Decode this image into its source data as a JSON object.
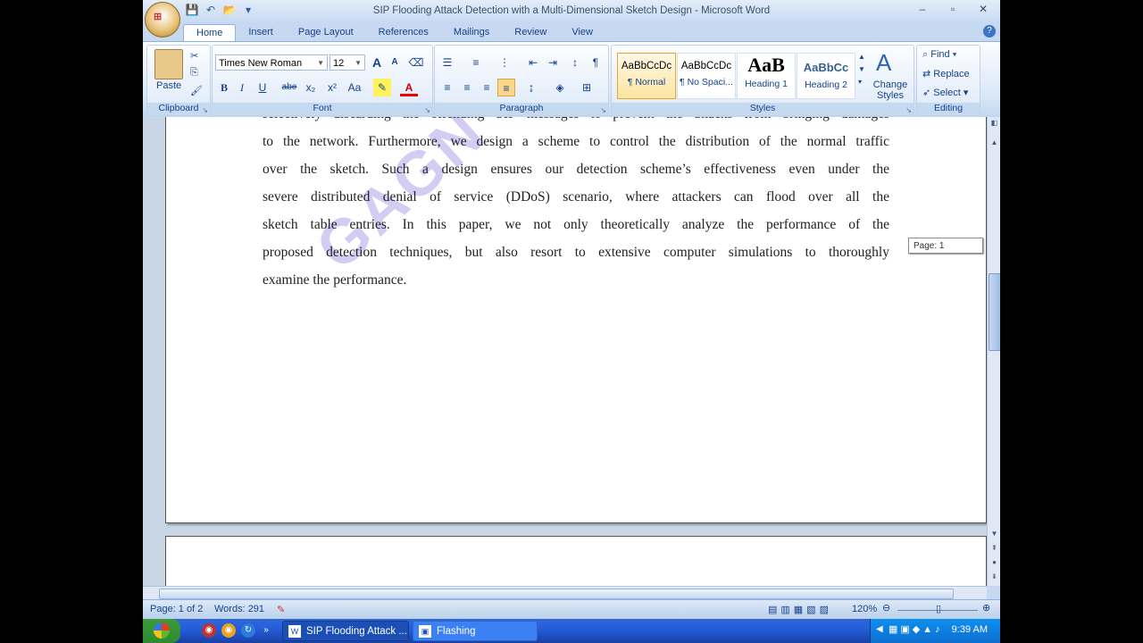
{
  "window": {
    "title": "SIP Flooding Attack Detection with a Multi-Dimensional Sketch Design - Microsoft Word",
    "minimize": "–",
    "maximize": "▫",
    "close": "✕"
  },
  "quick_access": {
    "save": "💾",
    "undo": "↶",
    "open": "📂",
    "customize": "▾"
  },
  "tabs": [
    "Home",
    "Insert",
    "Page Layout",
    "References",
    "Mailings",
    "Review",
    "View"
  ],
  "ribbon": {
    "clipboard": {
      "label": "Clipboard",
      "paste": "Paste"
    },
    "font": {
      "label": "Font",
      "name": "Times New Roman",
      "size": "12",
      "bold": "B",
      "italic": "I",
      "underline": "U",
      "strike": "abe",
      "subscript": "x₂",
      "superscript": "x²",
      "case": "Aa",
      "grow": "A",
      "shrink": "A"
    },
    "paragraph": {
      "label": "Paragraph"
    },
    "styles": {
      "label": "Styles",
      "cards": [
        {
          "sample": "AaBbCcDc",
          "name": "¶ Normal"
        },
        {
          "sample": "AaBbCcDc",
          "name": "¶ No Spaci..."
        },
        {
          "sample": "AaB",
          "name": "Heading 1"
        },
        {
          "sample": "AaBbCc",
          "name": "Heading 2"
        }
      ],
      "change_styles": "Change Styles"
    },
    "editing": {
      "label": "Editing",
      "find": "Find",
      "replace": "Replace",
      "select": "Select"
    }
  },
  "document": {
    "lines": [
      "selectively discarding the offending SIP messages to prevent the attacks from bringing damages",
      "to the network. Furthermore, we design a scheme to control the distribution of the normal traffic",
      "over the sketch. Such a design ensures our detection scheme’s effectiveness even under the",
      "severe distributed denial of service (DDoS) scenario, where attackers can flood over all the",
      "sketch table entries. In this paper, we not only theoretically analyze the performance of the",
      "proposed detection techniques, but also resort to extensive computer simulations to thoroughly",
      "examine the performance."
    ],
    "watermark": "GAGN",
    "page_tooltip": "Page: 1"
  },
  "statusbar": {
    "page": "Page: 1 of 2",
    "words": "Words: 291",
    "zoom": "120%"
  },
  "taskbar": {
    "items": [
      "SIP Flooding Attack ...",
      "Flashing"
    ],
    "more": "»",
    "time": "9:39 AM"
  }
}
